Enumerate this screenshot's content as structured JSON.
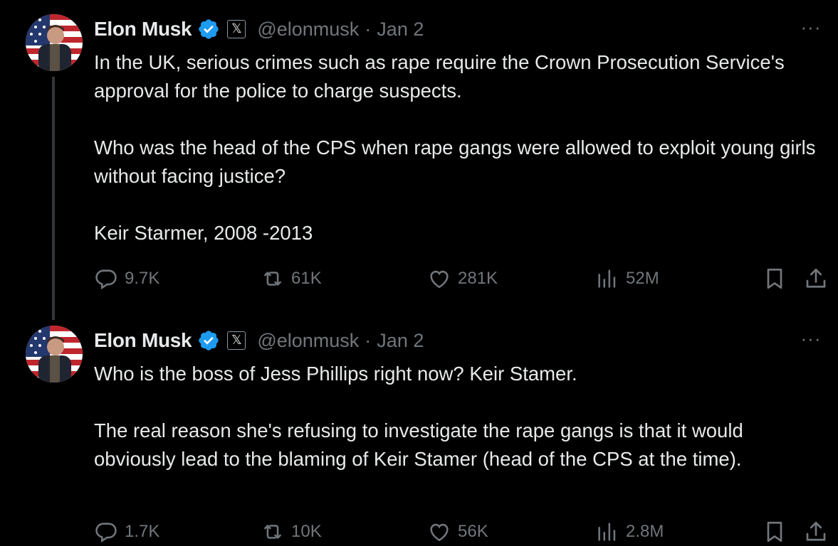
{
  "colors": {
    "background": "#000000",
    "text_primary": "#e7e9ea",
    "text_secondary": "#71767b",
    "verified_blue": "#1d9bf0",
    "thread_line": "#333639"
  },
  "tweets": [
    {
      "author": {
        "name": "Elon Musk",
        "handle": "@elonmusk",
        "badge_glyph": "𝕏",
        "verified_icon": "verified-badge-icon"
      },
      "separator": "·",
      "date": "Jan 2",
      "more": "···",
      "paragraphs": [
        "In the UK, serious crimes such as rape require the Crown Prosecution Service's approval for the police to charge suspects.",
        "Who was the head of the CPS when rape gangs were allowed to exploit young girls without facing justice?",
        "Keir Starmer, 2008 -2013"
      ],
      "stats": {
        "replies": "9.7K",
        "reposts": "61K",
        "likes": "281K",
        "views": "52M"
      }
    },
    {
      "author": {
        "name": "Elon Musk",
        "handle": "@elonmusk",
        "badge_glyph": "𝕏",
        "verified_icon": "verified-badge-icon"
      },
      "separator": "·",
      "date": "Jan 2",
      "more": "···",
      "paragraphs": [
        "Who is the boss of Jess Phillips right now? Keir Stamer.",
        "The real reason she's refusing to investigate the rape gangs is that it would obviously lead to the blaming of Keir Stamer (head of the CPS at the time)."
      ],
      "stats": {
        "replies": "1.7K",
        "reposts": "10K",
        "likes": "56K",
        "views": "2.8M"
      }
    }
  ]
}
